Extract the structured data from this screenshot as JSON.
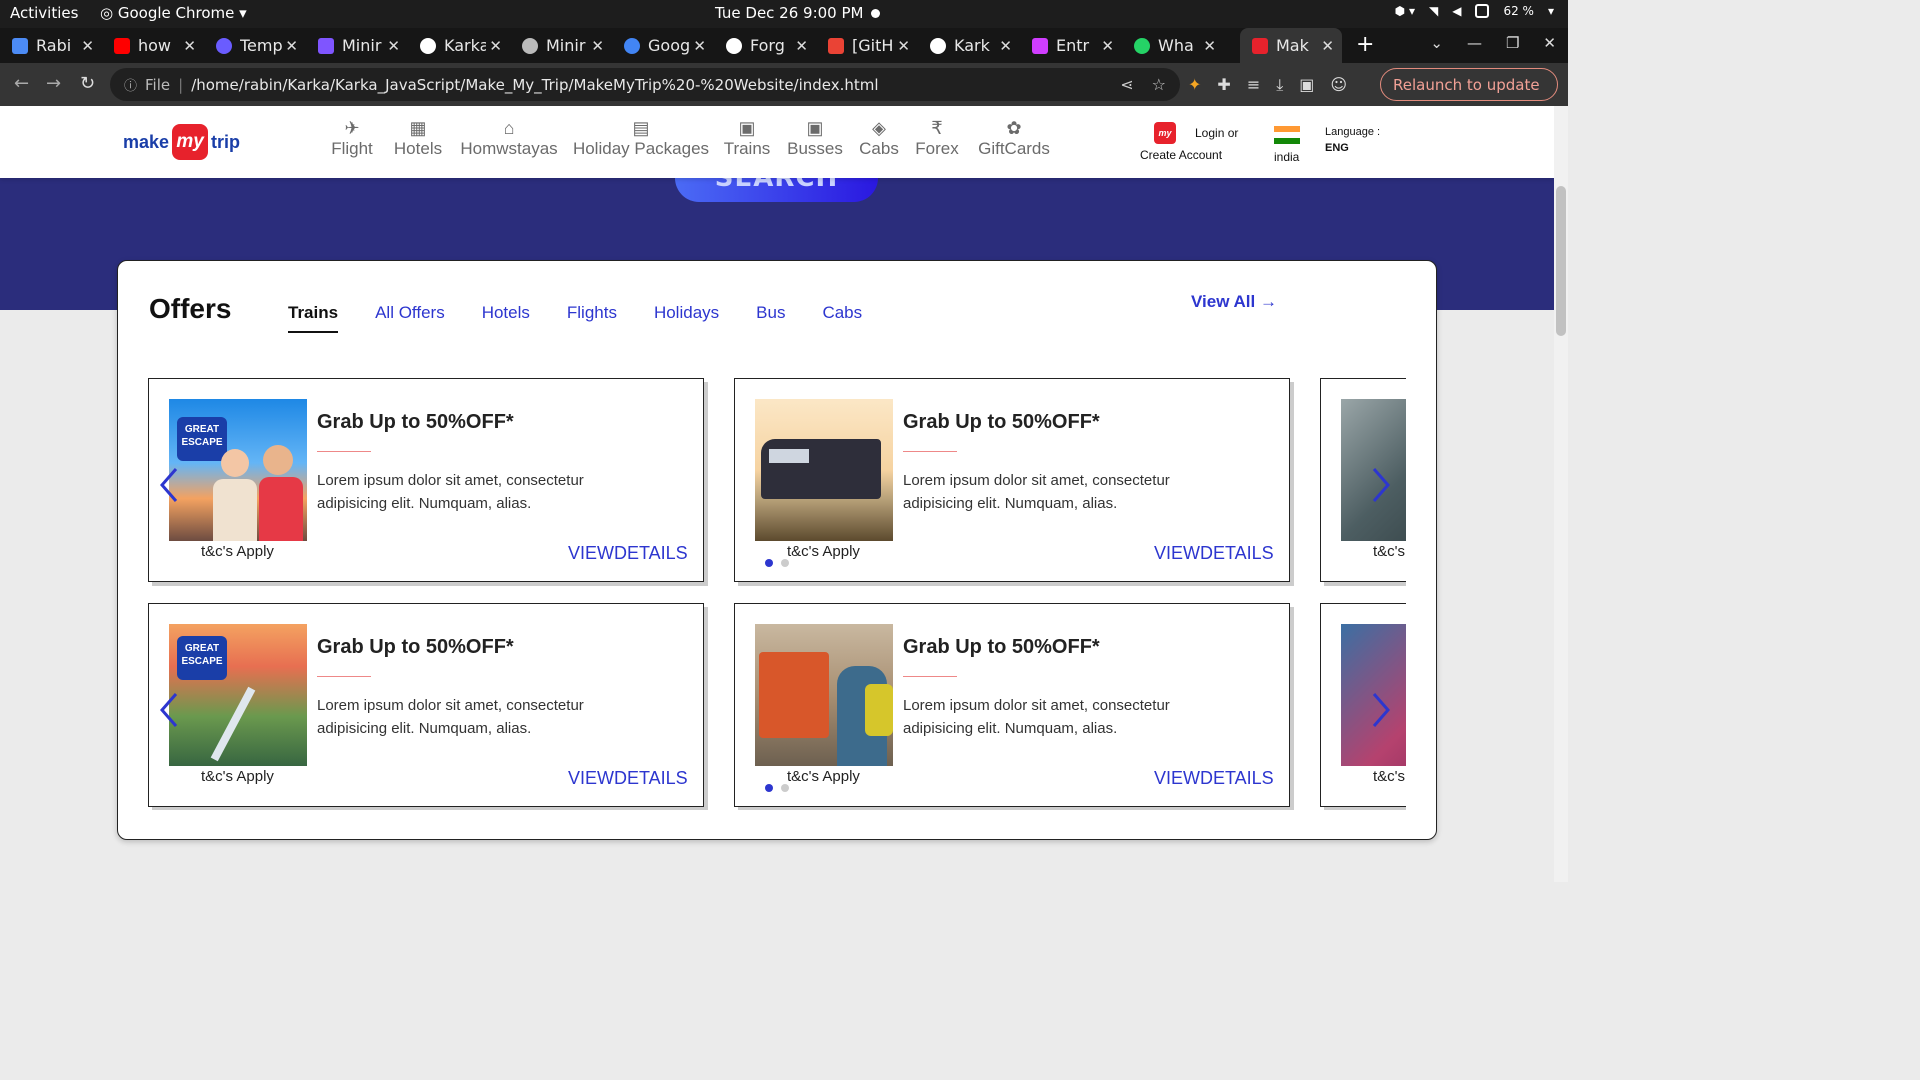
{
  "os_bar": {
    "activities": "Activities",
    "app": "Google Chrome",
    "clock": "Tue Dec 26  9:00 PM",
    "battery": "62 %"
  },
  "browser": {
    "tabs": [
      {
        "title": "Rabi",
        "color": "#4c8bf5"
      },
      {
        "title": "how",
        "color": "#ff0000"
      },
      {
        "title": "Temp",
        "color": "#6a5cff"
      },
      {
        "title": "Minir",
        "color": "#7f55ff"
      },
      {
        "title": "Karka",
        "color": "#ffffff"
      },
      {
        "title": "Minir",
        "color": "#bbbbbb"
      },
      {
        "title": "Goog",
        "color": "#4285f4"
      },
      {
        "title": "Forg",
        "color": "#ffffff"
      },
      {
        "title": "[GitH",
        "color": "#ea4335"
      },
      {
        "title": "Kark",
        "color": "#ffffff"
      },
      {
        "title": "Entr",
        "color": "#d03dff"
      },
      {
        "title": "Wha",
        "color": "#25d366"
      },
      {
        "title": "Mak",
        "color": "#e7222c"
      }
    ],
    "active_tab": 12,
    "omnibox": {
      "scheme_label": "File",
      "url": "/home/rabin/Karka/Karka_JavaScript/Make_My_Trip/MakeMyTrip%20-%20Website/index.html"
    },
    "relaunch_label": "Relaunch to update"
  },
  "site": {
    "logo": {
      "make": "make",
      "my": "my",
      "trip": "trip"
    },
    "nav": [
      "Flight",
      "Hotels",
      "Homwstayas",
      "Holiday Packages",
      "Trains",
      "Busses",
      "Cabs",
      "Forex",
      "GiftCards"
    ],
    "login_line1": "Login or",
    "login_line2": "Create Account",
    "login_badge": "my",
    "country": "india",
    "language_label": "Language :",
    "language_value": "ENG",
    "search_label": "SEARCH"
  },
  "offers": {
    "title": "Offers",
    "tabs": [
      "Trains",
      "All Offers",
      "Hotels",
      "Flights",
      "Holidays",
      "Bus",
      "Cabs"
    ],
    "active_tab": "Trains",
    "view_all": "View All →",
    "cards": [
      {
        "heading": "Grab Up to 50%OFF*",
        "desc": "Lorem ipsum dolor sit amet, consectetur adipisicing elit. Numquam, alias.",
        "tc": "t&c's Apply",
        "cta": "VIEWDETAILS",
        "banner": "GREAT ESCAPE"
      },
      {
        "heading": "Grab Up to 50%OFF*",
        "desc": "Lorem ipsum dolor sit amet, consectetur adipisicing elit. Numquam, alias.",
        "tc": "t&c's Apply",
        "cta": "VIEWDETAILS"
      },
      {
        "tc": "t&c's"
      },
      {
        "heading": "Grab Up to 50%OFF*",
        "desc": "Lorem ipsum dolor sit amet, consectetur adipisicing elit. Numquam, alias.",
        "tc": "t&c's Apply",
        "cta": "VIEWDETAILS",
        "banner": "GREAT ESCAPE"
      },
      {
        "heading": "Grab Up to 50%OFF*",
        "desc": "Lorem ipsum dolor sit amet, consectetur adipisicing elit. Numquam, alias.",
        "tc": "t&c's Apply",
        "cta": "VIEWDETAILS"
      },
      {
        "tc": "t&c's"
      }
    ]
  },
  "colors": {
    "brand_red": "#e7222c",
    "accent_blue": "#2d36cf",
    "hero_band": "#2b2d7c"
  }
}
